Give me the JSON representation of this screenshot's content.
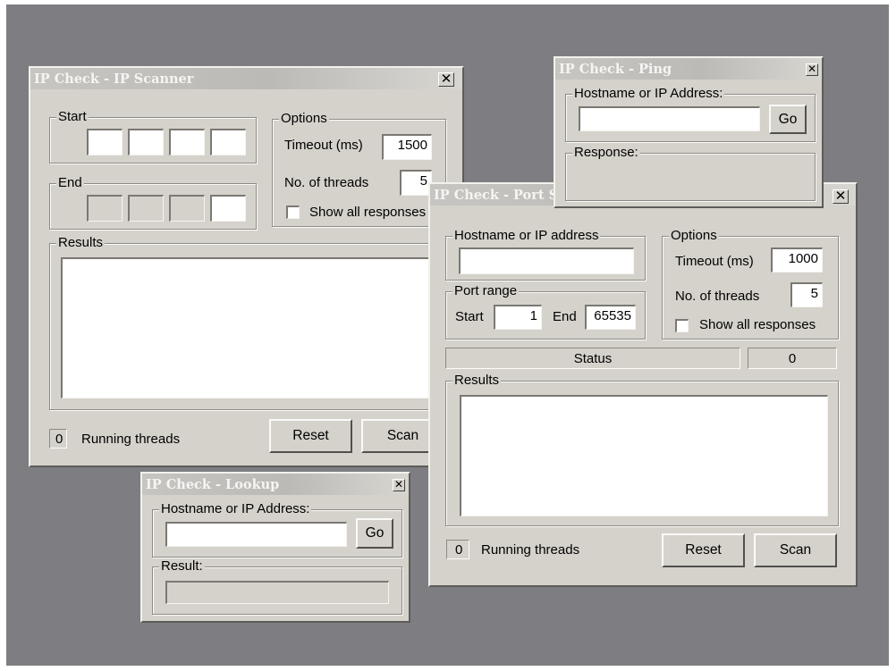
{
  "scanner": {
    "title": "IP Check - IP Scanner",
    "start_label": "Start",
    "end_label": "End",
    "options_label": "Options",
    "timeout_label": "Timeout (ms)",
    "timeout_value": "1500",
    "threads_label": "No. of threads",
    "threads_value": "5",
    "show_all_label": "Show all responses",
    "results_label": "Results",
    "running_count": "0",
    "running_label": "Running threads",
    "reset_label": "Reset",
    "scan_label": "Scan"
  },
  "ping": {
    "title": "IP Check - Ping",
    "host_label": "Hostname or IP Address:",
    "host_value": "",
    "go_label": "Go",
    "response_label": "Response:"
  },
  "port": {
    "title": "IP Check - Port Scanner",
    "host_label": "Hostname or IP address",
    "host_value": "",
    "port_range_label": "Port range",
    "start_label": "Start",
    "start_value": "1",
    "end_label": "End",
    "end_value": "65535",
    "options_label": "Options",
    "timeout_label": "Timeout (ms)",
    "timeout_value": "1000",
    "threads_label": "No. of threads",
    "threads_value": "5",
    "show_all_label": "Show all responses",
    "status_label": "Status",
    "status_count": "0",
    "results_label": "Results",
    "running_count": "0",
    "running_label": "Running threads",
    "reset_label": "Reset",
    "scan_label": "Scan"
  },
  "lookup": {
    "title": "IP Check - Lookup",
    "host_label": "Hostname or IP Address:",
    "host_value": "",
    "go_label": "Go",
    "result_label": "Result:",
    "result_value": ""
  }
}
